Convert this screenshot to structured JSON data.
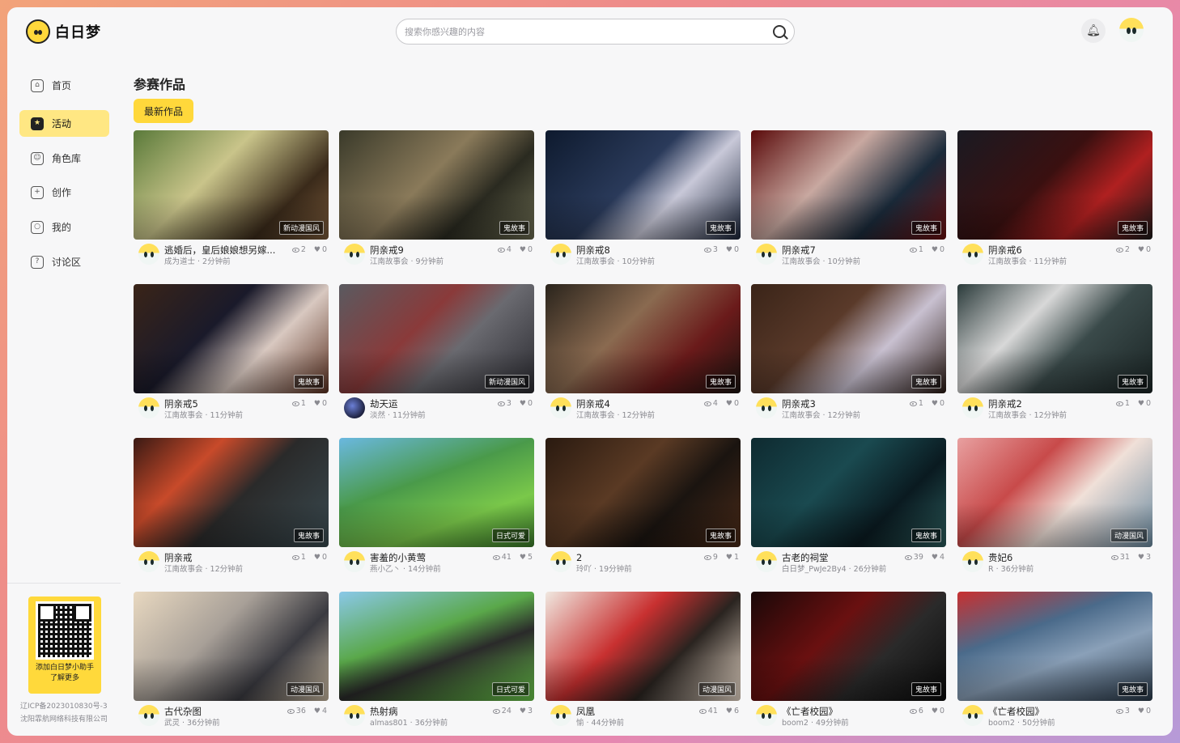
{
  "header": {
    "logo_text": "白日梦",
    "search_placeholder": "搜索你感兴趣的内容"
  },
  "sidebar": {
    "items": [
      {
        "label": "首页",
        "icon": "home-icon",
        "glyph": "⌂",
        "active": false
      },
      {
        "label": "活动",
        "icon": "activity-icon",
        "glyph": "★",
        "active": true
      },
      {
        "label": "角色库",
        "icon": "character-icon",
        "glyph": "☺",
        "active": false
      },
      {
        "label": "创作",
        "icon": "create-icon",
        "glyph": "+",
        "active": false
      },
      {
        "label": "我的",
        "icon": "profile-icon",
        "glyph": "○",
        "active": false
      },
      {
        "label": "讨论区",
        "icon": "discussion-icon",
        "glyph": "?",
        "active": false
      }
    ],
    "qr_text_1": "添加白日梦小助手",
    "qr_text_2": "了解更多",
    "icp": "辽ICP备2023010830号-3",
    "company": "沈阳霏航网络科技有限公司"
  },
  "main": {
    "title": "参赛作品",
    "filter_label": "最新作品",
    "cards": [
      {
        "title": "逃婚后，皇后娘娘想另嫁...",
        "meta": "成为道士 · 2分钟前",
        "views": "2",
        "likes": "0",
        "tag": "新动漫国风",
        "bg": "linear-gradient(135deg,#5a7a3a,#c9c48a 40%,#3a2a1a 75%,#7a5a3a)"
      },
      {
        "title": "阴亲戒9",
        "meta": "江南故事会 · 9分钟前",
        "views": "4",
        "likes": "0",
        "tag": "鬼故事",
        "bg": "linear-gradient(135deg,#3a3a2a,#8a7a5a 45%,#2a2a20 70%,#6a6a50)"
      },
      {
        "title": "阴亲戒8",
        "meta": "江南故事会 · 10分钟前",
        "views": "3",
        "likes": "0",
        "tag": "鬼故事",
        "bg": "linear-gradient(135deg,#0e1a2e,#2a3a5a 45%,#c8c8d8 65%,#1a2438)"
      },
      {
        "title": "阴亲戒7",
        "meta": "江南故事会 · 10分钟前",
        "views": "1",
        "likes": "0",
        "tag": "鬼故事",
        "bg": "linear-gradient(135deg,#5a0a0a,#c8a8a0 40%,#1a2a3a 70%,#6a1010)"
      },
      {
        "title": "阴亲戒6",
        "meta": "江南故事会 · 11分钟前",
        "views": "2",
        "likes": "0",
        "tag": "鬼故事",
        "bg": "linear-gradient(135deg,#1a1a22,#3a1010 45%,#b02020 70%,#1a1a1a)"
      },
      {
        "title": "阴亲戒5",
        "meta": "江南故事会 · 11分钟前",
        "views": "1",
        "likes": "0",
        "tag": "鬼故事",
        "bg": "linear-gradient(135deg,#3a2418,#1a1a2a 40%,#d8c8c0 65%,#5a3020)"
      },
      {
        "title": "劫天运",
        "meta": "淡然 · 11分钟前",
        "views": "3",
        "likes": "0",
        "tag": "新动漫国风",
        "bg": "linear-gradient(135deg,#5a5a60,#8a3a3a 40%,#6a6a70 60%,#2a2a30)",
        "dark_avatar": true
      },
      {
        "title": "阴亲戒4",
        "meta": "江南故事会 · 12分钟前",
        "views": "4",
        "likes": "0",
        "tag": "鬼故事",
        "bg": "linear-gradient(135deg,#2a241c,#8a6a50 40%,#6a1a1a 70%,#1a1410)"
      },
      {
        "title": "阴亲戒3",
        "meta": "江南故事会 · 12分钟前",
        "views": "1",
        "likes": "0",
        "tag": "鬼故事",
        "bg": "linear-gradient(135deg,#3a2418,#5a3a2a 40%,#c8c0d0 65%,#2a1a14)"
      },
      {
        "title": "阴亲戒2",
        "meta": "江南故事会 · 12分钟前",
        "views": "1",
        "likes": "0",
        "tag": "鬼故事",
        "bg": "linear-gradient(135deg,#2a3a3a,#d8d8d8 35%,#3a4a4a 60%,#1a2424)"
      },
      {
        "title": "阴亲戒",
        "meta": "江南故事会 · 12分钟前",
        "views": "1",
        "likes": "0",
        "tag": "鬼故事",
        "bg": "linear-gradient(135deg,#3a1a14,#c84a2a 30%,#2a2a2a 55%,#3a4a50)"
      },
      {
        "title": "害羞的小黄莺",
        "meta": "燕小乙丶 · 14分钟前",
        "views": "41",
        "likes": "5",
        "tag": "日式可爱",
        "bg": "linear-gradient(160deg,#6ab8e0,#4a9a4a 40%,#7ac84a 70%,#3a7a2a)"
      },
      {
        "title": "2",
        "meta": "玲吖 · 19分钟前",
        "views": "9",
        "likes": "1",
        "tag": "鬼故事",
        "bg": "linear-gradient(135deg,#2a1a10,#5a3a24 40%,#1a1410 65%,#4a2a18)"
      },
      {
        "title": "古老的祠堂",
        "meta": "白日梦_PwJe2By4 · 26分钟前",
        "views": "39",
        "likes": "4",
        "tag": "鬼故事",
        "bg": "linear-gradient(135deg,#0e2a30,#1a4a50 40%,#0a1a20 70%,#2a5a5a)"
      },
      {
        "title": "贵妃6",
        "meta": "R · 36分钟前",
        "views": "31",
        "likes": "3",
        "tag": "动漫国风",
        "bg": "linear-gradient(135deg,#e8a0a0,#c84a4a 35%,#f0e0d8 60%,#6a8aa0)"
      },
      {
        "title": "古代杂图",
        "meta": "武灵 · 36分钟前",
        "views": "36",
        "likes": "4",
        "tag": "动漫国风",
        "bg": "linear-gradient(135deg,#e8d8c0,#a8a098 40%,#3a3a40 70%,#c8b8a0)"
      },
      {
        "title": "热射病",
        "meta": "almas801 · 36分钟前",
        "views": "24",
        "likes": "3",
        "tag": "日式可爱",
        "bg": "linear-gradient(160deg,#8ac8e8,#5aa84a 40%,#2a2a2a 60%,#6ac84a)"
      },
      {
        "title": "凤凰",
        "meta": "愉 · 44分钟前",
        "views": "41",
        "likes": "6",
        "tag": "动漫国风",
        "bg": "linear-gradient(135deg,#f0e8e0,#c83030 40%,#2a2420 65%,#e8d8c8)"
      },
      {
        "title": "《亡者校园》",
        "meta": "boom2 · 49分钟前",
        "views": "6",
        "likes": "0",
        "tag": "鬼故事",
        "bg": "linear-gradient(135deg,#1a0808,#6a1010 40%,#2a2a2a 65%,#0a0a0a)"
      },
      {
        "title": "《亡者校园》",
        "meta": "boom2 · 50分钟前",
        "views": "3",
        "likes": "0",
        "tag": "鬼故事",
        "bg": "linear-gradient(160deg,#c83030,#4a6a8a 35%,#8aa0b8 60%,#2a3a4a)"
      }
    ]
  }
}
